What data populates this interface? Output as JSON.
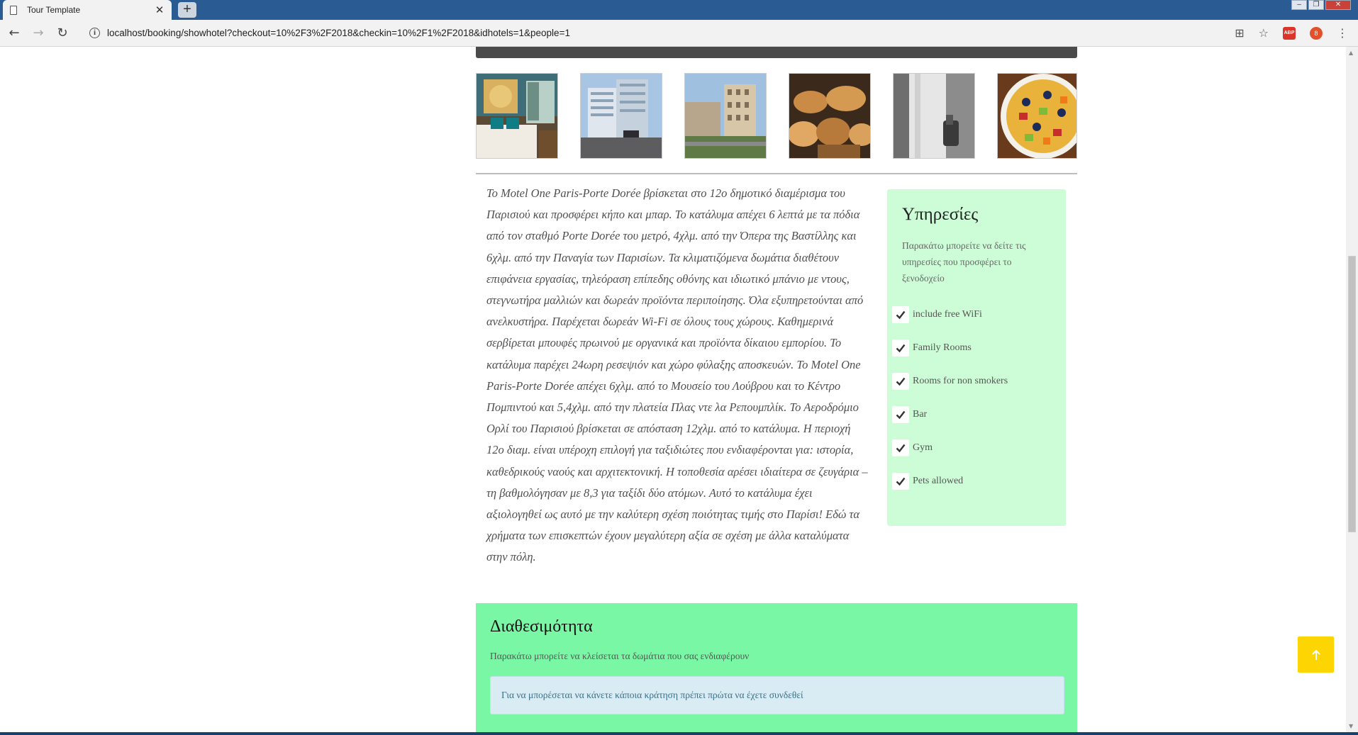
{
  "browser": {
    "tab_title": "Tour Template",
    "tab_close": "✕",
    "new_tab": "+",
    "url": "localhost/booking/showhotel?checkout=10%2F3%2F2018&checkin=10%2F1%2F2018&idhotels=1&people=1",
    "ext_abp_label": "ABP",
    "ext_badge_count": "8",
    "icons": {
      "back": "back-arrow-icon",
      "forward": "forward-arrow-icon",
      "reload": "reload-icon",
      "info": "info-icon",
      "translate": "translate-icon",
      "bookmark": "star-icon",
      "menu": "kebab-menu-icon"
    }
  },
  "hotel": {
    "gallery": [
      {
        "name": "room-photo",
        "icon": "hotel-room"
      },
      {
        "name": "building-photo-1",
        "icon": "building"
      },
      {
        "name": "building-photo-2",
        "icon": "building-street"
      },
      {
        "name": "breakfast-pastries-photo",
        "icon": "pastries"
      },
      {
        "name": "towel-photo",
        "icon": "towel"
      },
      {
        "name": "fruit-salad-photo",
        "icon": "fruit-salad"
      }
    ],
    "description": "Το Motel One Paris-Porte Dorée βρίσκεται στο 12ο δημοτικό διαμέρισμα του Παρισιού και προσφέρει κήπο και μπαρ. Το κατάλυμα απέχει 6 λεπτά με τα πόδια από τον σταθμό Porte Dorée του μετρό, 4χλμ. από την Όπερα της Βαστίλλης και 6χλμ. από την Παναγία των Παρισίων. Τα κλιματιζόμενα δωμάτια διαθέτουν επιφάνεια εργασίας, τηλεόραση επίπεδης οθόνης και ιδιωτικό μπάνιο με ντους, στεγνωτήρα μαλλιών και δωρεάν προϊόντα περιποίησης. Όλα εξυπηρετούνται από ανελκυστήρα. Παρέχεται δωρεάν Wi-Fi σε όλους τους χώρους. Καθημερινά σερβίρεται μπουφές πρωινού με οργανικά και προϊόντα δίκαιου εμπορίου. Το κατάλυμα παρέχει 24ωρη ρεσεψιόν και χώρο φύλαξης αποσκευών. Το Motel One Paris-Porte Dorée απέχει 6χλμ. από το Μουσείο του Λούβρου και το Κέντρο Πομπιντού και 5,4χλμ. από την πλατεία Πλας ντε λα Ρεπουμπλίκ. Το Αεροδρόμιο Ορλί του Παρισιού βρίσκεται σε απόσταση 12χλμ. από το κατάλυμα. Η περιοχή 12ο διαμ. είναι υπέροχη επιλογή για ταξιδιώτες που ενδιαφέρονται για: ιστορία, καθεδρικούς ναούς και αρχιτεκτονική. Η τοποθεσία αρέσει ιδιαίτερα σε ζευγάρια – τη βαθμολόγησαν με 8,3 για ταξίδι δύο ατόμων. Αυτό το κατάλυμα έχει αξιολογηθεί ως αυτό με την καλύτερη σχέση ποιότητας τιμής στο Παρίσι! Εδώ τα χρήματα των επισκεπτών έχουν μεγαλύτερη αξία σε σχέση με άλλα καταλύματα στην πόλη."
  },
  "services": {
    "title": "Υπηρεσίες",
    "intro": "Παρακάτω μπορείτε να δείτε τις υπηρεσίες που προσφέρει το ξενοδοχείο",
    "items": [
      "include free WiFi",
      "Family Rooms",
      "Rooms for non smokers",
      "Bar",
      "Gym",
      "Pets allowed"
    ],
    "panel_color": "#ccfdd6"
  },
  "availability": {
    "title": "Διαθεσιμότητα",
    "subtitle": "Παρακάτω μπορείτε να κλείσεται τα δωμάτια που σας ενδιαφέρουν",
    "login_notice": "Για να μπορέσεται να κάνετε κάποια κράτηση πρέπει πρώτα να έχετε συνδεθεί",
    "panel_color": "#7af7a4"
  },
  "back_to_top": {
    "icon": "arrow-up-icon",
    "color": "#fcd503"
  }
}
